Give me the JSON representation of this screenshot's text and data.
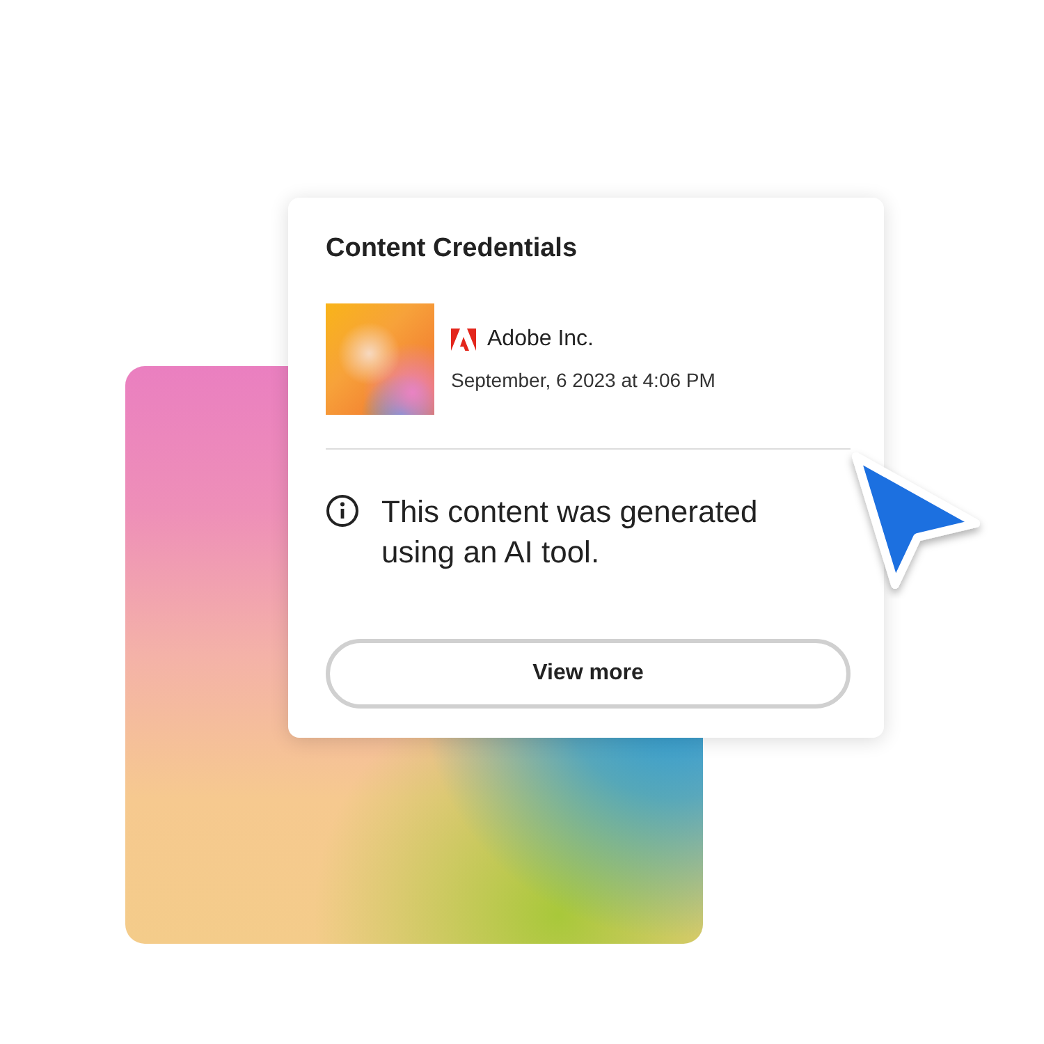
{
  "panel": {
    "title": "Content Credentials",
    "issuer": "Adobe Inc.",
    "date": "September, 6 2023 at 4:06 PM",
    "message": "This content was generated using an AI tool.",
    "button": "View more"
  }
}
